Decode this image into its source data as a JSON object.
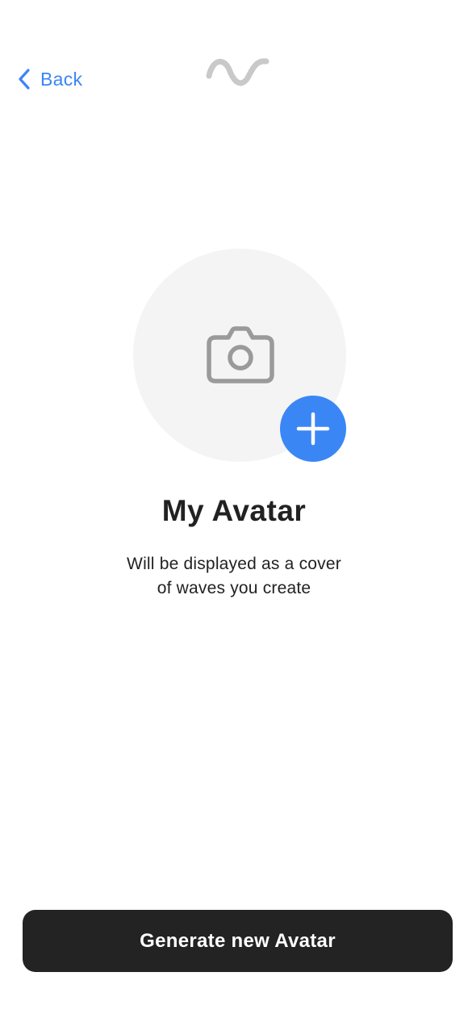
{
  "nav": {
    "back_label": "Back",
    "back_icon": "chevron-left-icon",
    "logo_icon": "wave-logo-icon"
  },
  "avatar": {
    "placeholder_icon": "camera-icon",
    "add_icon": "plus-icon"
  },
  "content": {
    "title": "My Avatar",
    "subtitle_line1": "Will be displayed as a cover",
    "subtitle_line2": "of waves you create"
  },
  "actions": {
    "generate_label": "Generate new Avatar"
  },
  "colors": {
    "accent": "#3a86f5",
    "logo_gray": "#c9c9c9",
    "icon_gray": "#9a9a9a",
    "avatar_bg": "#f4f4f4",
    "text_dark": "#222222",
    "button_bg": "#232323",
    "button_text": "#ffffff"
  }
}
